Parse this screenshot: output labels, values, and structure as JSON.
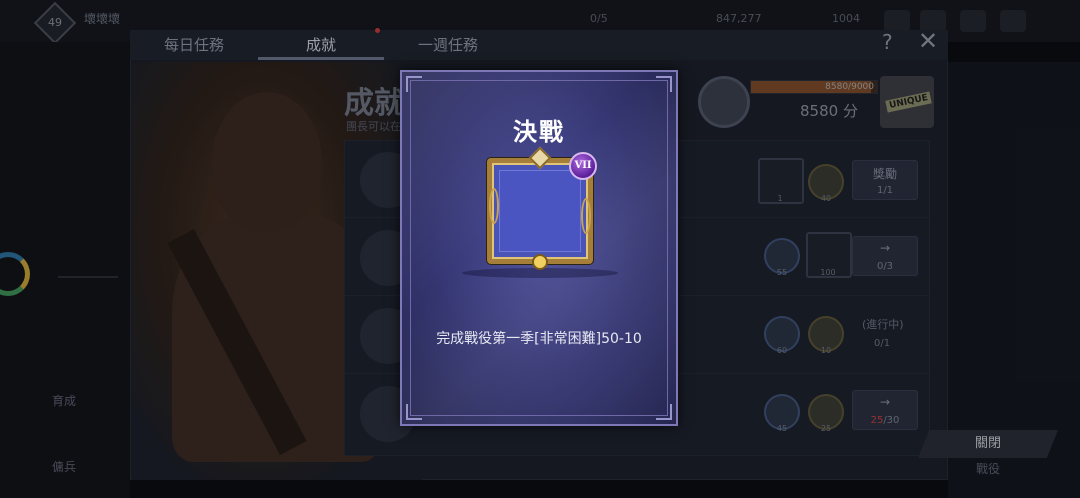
{
  "topbar": {
    "level": "49",
    "player_name": "壞壞壞",
    "resource_1": "0/5",
    "resource_2": "847,277",
    "resource_3": "1004"
  },
  "tabs": [
    {
      "label": "每日任務"
    },
    {
      "label": "成就"
    },
    {
      "label": "一週任務"
    }
  ],
  "header": {
    "help_icon": "?",
    "close_icon": "✕"
  },
  "achievements": {
    "title": "成就",
    "subtitle": "團長可以在",
    "points_bar_text": "8580/9000",
    "points_fraction": 0.953,
    "points_text": "8580 分",
    "unique_label": "UNIQUE"
  },
  "rows": [
    {
      "rewards": [
        "1",
        "40"
      ],
      "button_label": "獎勵",
      "button_count": "1/1"
    },
    {
      "rewards": [
        "55",
        "100"
      ],
      "button_label": "→",
      "button_count": "0/3"
    },
    {
      "rewards": [
        "60",
        "10"
      ],
      "status": "(進行中)",
      "progress": "0/1"
    },
    {
      "rewards": [
        "45",
        "25"
      ],
      "button_label": "→",
      "progress_red": "25",
      "progress_rest": "/30"
    }
  ],
  "left_nav": [
    {
      "label": "育成"
    },
    {
      "label": "傭兵"
    }
  ],
  "right_nav": [
    {
      "label": "戰役"
    }
  ],
  "footer": {
    "close_button": "關閉"
  },
  "modal": {
    "title": "決戰",
    "rank_badge": "VII",
    "description": "完成戰役第一季[非常困難]50-10",
    "frame_color": "#a57f3a",
    "panel_color": "#353672"
  }
}
